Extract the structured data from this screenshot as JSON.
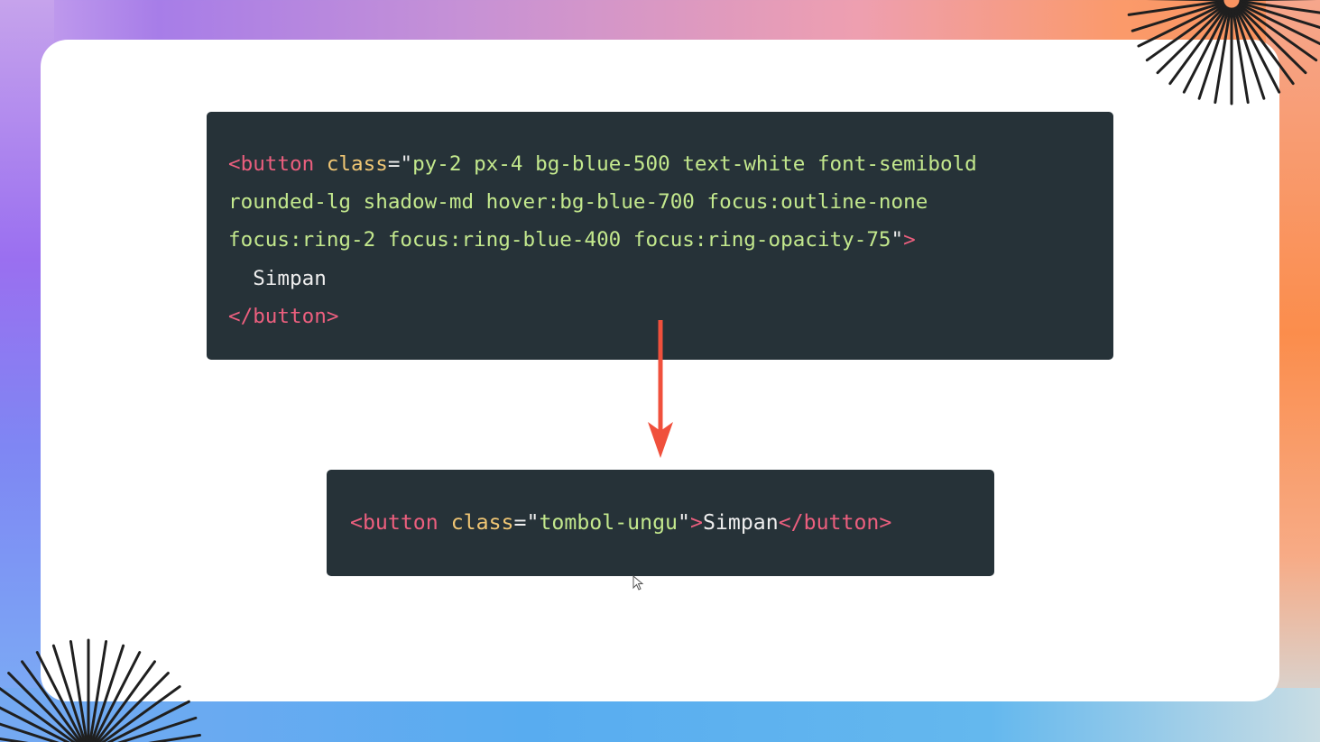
{
  "slide": {
    "code_before": {
      "lines": [
        [
          {
            "text": "<button",
            "kind": "tag"
          },
          {
            "text": " ",
            "kind": "txt"
          },
          {
            "text": "class",
            "kind": "attr"
          },
          {
            "text": "=\"",
            "kind": "txt"
          },
          {
            "text": "py-2 px-4 bg-blue-500 text-white font-semibold",
            "kind": "str"
          }
        ],
        [
          {
            "text": "rounded-lg shadow-md hover:bg-blue-700 focus:outline-none",
            "kind": "str"
          }
        ],
        [
          {
            "text": "focus:ring-2 focus:ring-blue-400 focus:ring-opacity-75",
            "kind": "str"
          },
          {
            "text": "\"",
            "kind": "txt"
          },
          {
            "text": ">",
            "kind": "tag"
          }
        ],
        [
          {
            "text": "  Simpan",
            "kind": "txt"
          }
        ],
        [
          {
            "text": "</button>",
            "kind": "tag"
          }
        ]
      ]
    },
    "code_after": {
      "lines": [
        [
          {
            "text": "<button",
            "kind": "tag"
          },
          {
            "text": " ",
            "kind": "txt"
          },
          {
            "text": "class",
            "kind": "attr"
          },
          {
            "text": "=\"",
            "kind": "txt"
          },
          {
            "text": "tombol-ungu",
            "kind": "str"
          },
          {
            "text": "\"",
            "kind": "txt"
          },
          {
            "text": ">",
            "kind": "tag"
          },
          {
            "text": "Simpan",
            "kind": "txt"
          },
          {
            "text": "</button>",
            "kind": "tag"
          }
        ]
      ]
    },
    "arrow": {
      "icon": "arrow-down-icon",
      "color": "#f0503c"
    },
    "decorations": {
      "burst_color": "#1f1f1f"
    }
  },
  "colors": {
    "code_background": "#263238",
    "tag": "#ec5f7e",
    "attribute": "#f0c674",
    "string": "#c3e88d",
    "text": "#eeeeee"
  }
}
